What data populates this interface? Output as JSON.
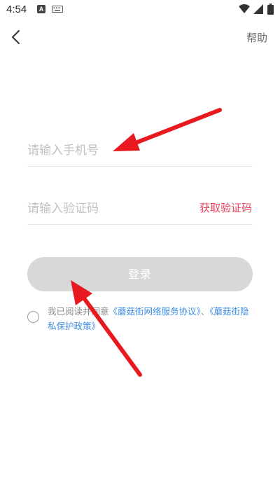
{
  "status_bar": {
    "time": "4:54",
    "notification_letter": "A",
    "icons": [
      "notification-a-icon",
      "keyboard-icon",
      "wifi-icon",
      "signal-icon",
      "battery-icon"
    ]
  },
  "header": {
    "back_icon": "chevron-left-icon",
    "help_label": "帮助"
  },
  "form": {
    "phone_placeholder": "请输入手机号",
    "code_placeholder": "请输入验证码",
    "get_code_label": "获取验证码",
    "login_label": "登录"
  },
  "agreement": {
    "prefix": "我已阅读并同意",
    "service_link": "《蘑菇街网络服务协议》",
    "separator": "、",
    "privacy_link": "《蘑菇街隐私保护政策》"
  },
  "colors": {
    "accent_red": "#e94560",
    "link_blue": "#3e8ee0",
    "button_disabled": "#d8d8d8",
    "annotation_arrow": "#e8191f"
  }
}
